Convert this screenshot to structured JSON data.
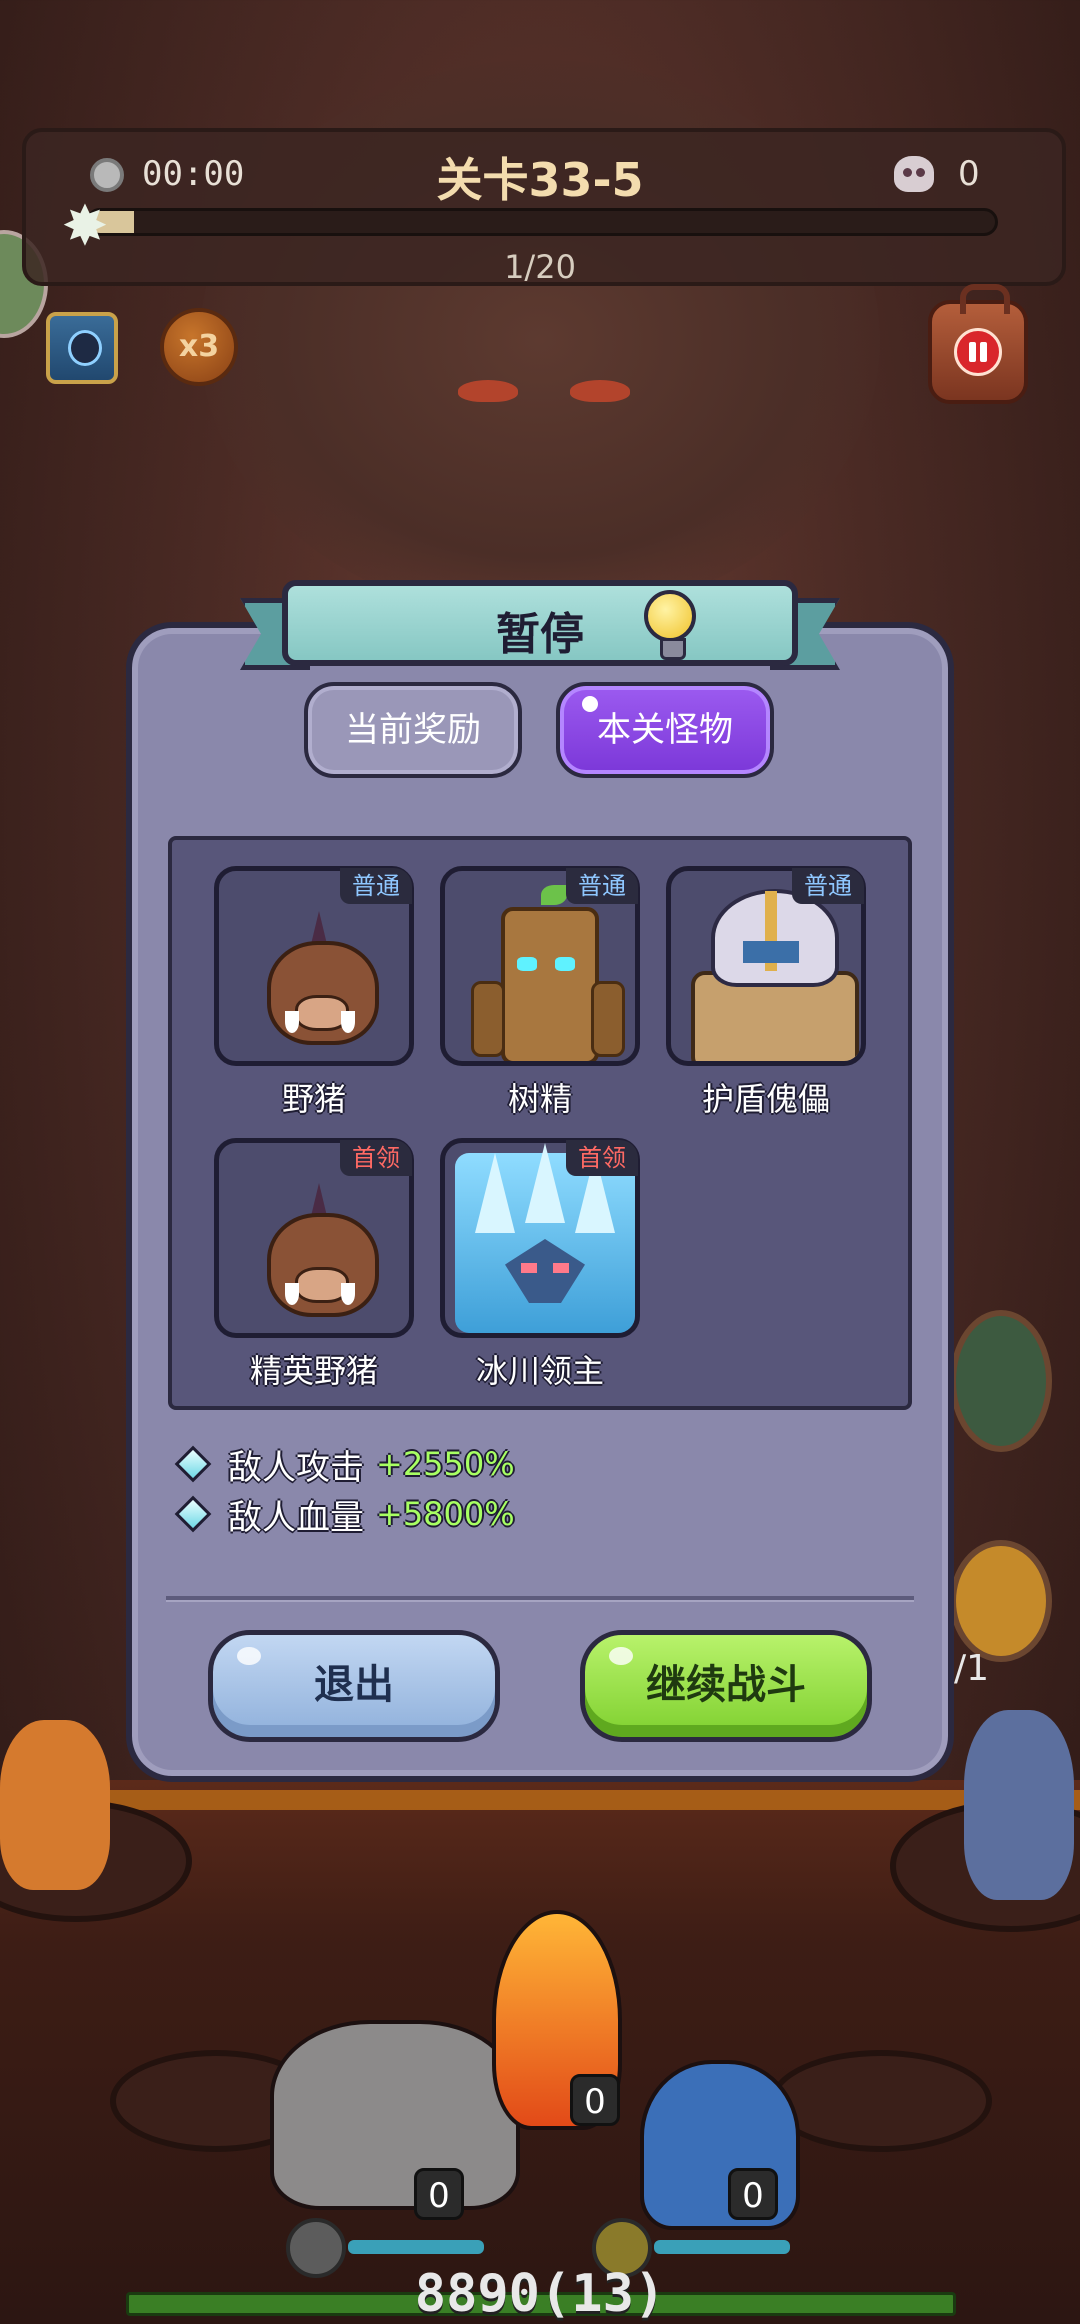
{
  "hud": {
    "timer": "00:00",
    "level_title": "关卡33-5",
    "kill_count": "0",
    "wave_progress_fraction": 0.05,
    "wave_text": "1/20",
    "speed_label": "x3"
  },
  "dialog": {
    "title": "暂停",
    "tabs": [
      {
        "label": "当前奖励",
        "active": false
      },
      {
        "label": "本关怪物",
        "active": true
      }
    ],
    "monsters": [
      {
        "name": "野猪",
        "rank": "普通",
        "icon": "boar-icon"
      },
      {
        "name": "树精",
        "rank": "普通",
        "icon": "treant-icon"
      },
      {
        "name": "护盾傀儡",
        "rank": "普通",
        "icon": "shield-golem-icon"
      },
      {
        "name": "精英野猪",
        "rank": "首领",
        "icon": "elite-boar-icon"
      },
      {
        "name": "冰川领主",
        "rank": "首领",
        "icon": "glacier-lord-icon"
      }
    ],
    "bonuses": [
      {
        "label": "敌人攻击",
        "value": "+2550%"
      },
      {
        "label": "敌人血量",
        "value": "+5800%"
      }
    ],
    "buttons": {
      "exit": "退出",
      "continue": "继续战斗"
    }
  },
  "battle": {
    "hero_counts": [
      "0",
      "0",
      "0"
    ],
    "hp_text": "8890(13)",
    "side_fraction": "/1"
  },
  "colors": {
    "dialog_bg": "#8a88ab",
    "active_tab": "#8b47e4",
    "continue_button": "#8fde3c",
    "exit_button": "#a6c2e6",
    "bonus_value": "#a8ff63",
    "boss_rank": "#ff6a64",
    "normal_rank": "#8fc7ff"
  }
}
